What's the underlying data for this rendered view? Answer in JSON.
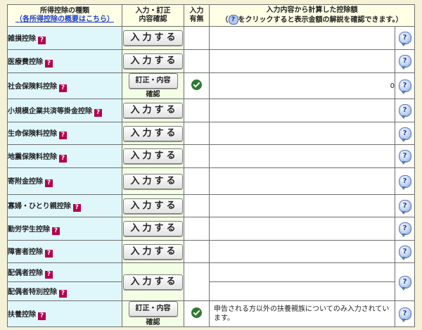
{
  "header": {
    "col_kind_line1": "所得控除の種類",
    "col_kind_link": "（各所得控除の概要はこちら）",
    "col_input_line1": "入力・訂正",
    "col_input_line2": "内容確認",
    "col_flag_line1": "入力",
    "col_flag_line2": "有無",
    "col_amount_line1": "入力内容から計算した控除額",
    "col_amount_line2_pre": "（",
    "col_amount_line2_icon": "?",
    "col_amount_line2_post": "をクリックすると表示金額の解説を確認できます。）"
  },
  "help_mark": "?",
  "rows": [
    {
      "name": "雑損控除",
      "button": "入力する",
      "button_type": "input",
      "has_input": false,
      "amount": ""
    },
    {
      "name": "医療費控除",
      "button": "入力する",
      "button_type": "input",
      "has_input": false,
      "amount": ""
    },
    {
      "name": "社会保険料控除",
      "button": "訂正・内容確認",
      "button_type": "edit",
      "has_input": true,
      "amount": "0"
    },
    {
      "name": "小規模企業共済等掛金控除",
      "button": "入力する",
      "button_type": "input",
      "has_input": false,
      "amount": ""
    },
    {
      "name": "生命保険料控除",
      "button": "入力する",
      "button_type": "input",
      "has_input": false,
      "amount": ""
    },
    {
      "name": "地震保険料控除",
      "button": "入力する",
      "button_type": "input",
      "has_input": false,
      "amount": ""
    },
    {
      "name": "寄附金控除",
      "button": "入力する",
      "button_type": "input",
      "has_input": false,
      "amount": ""
    },
    {
      "name": "寡婦・ひとり親控除",
      "button": "入力する",
      "button_type": "input",
      "has_input": false,
      "amount": ""
    },
    {
      "name": "勤労学生控除",
      "button": "入力する",
      "button_type": "input",
      "has_input": false,
      "amount": ""
    },
    {
      "name": "障害者控除",
      "button": "入力する",
      "button_type": "input",
      "has_input": false,
      "amount": ""
    }
  ],
  "spouse": {
    "name1": "配偶者控除",
    "name2": "配偶者特別控除",
    "button": "入力する",
    "has_input": false,
    "amount1": "",
    "amount2": ""
  },
  "dependents": {
    "name": "扶養控除",
    "button": "訂正・内容確認",
    "has_input": true,
    "amount": "申告される方以外の扶養親族についてのみ入力されています。"
  }
}
